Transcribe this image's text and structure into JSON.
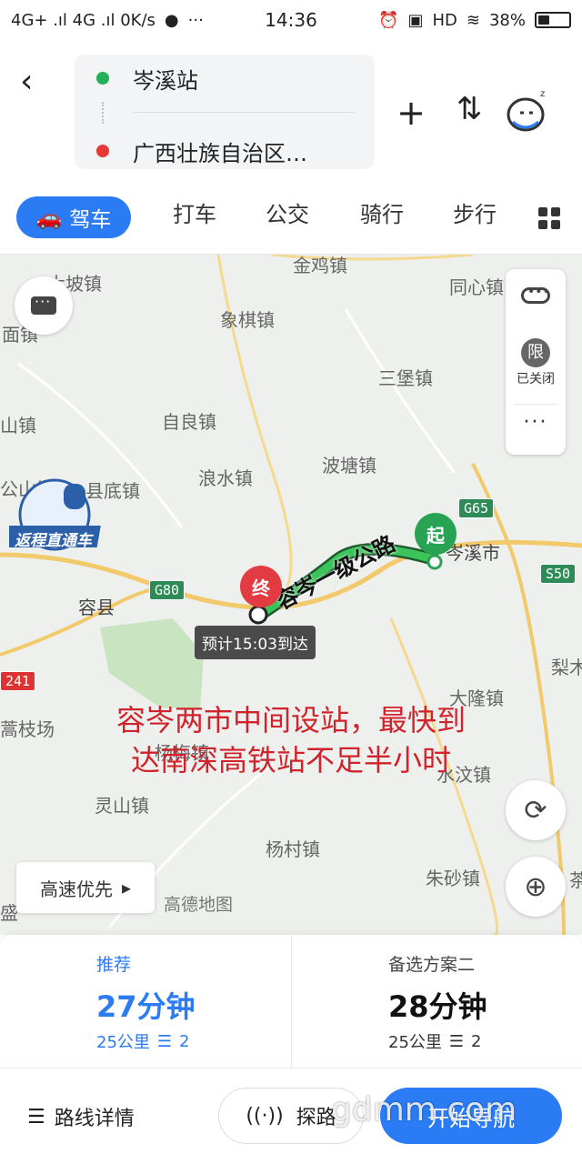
{
  "status_bar": {
    "network": "4G+ .ıl 4G .ıl 0K/s",
    "extra": "···",
    "time": "14:36",
    "right": "HD",
    "battery": "38%"
  },
  "header": {
    "origin": "岑溪站",
    "destination": "广西壮族自治区…",
    "colors": {
      "origin_dot": "#22b05a",
      "destination_dot": "#e53935"
    }
  },
  "tabs": {
    "active": "驾车",
    "items": [
      "打车",
      "公交",
      "骑行",
      "步行"
    ]
  },
  "map": {
    "places": [
      {
        "text": "金鸡镇"
      },
      {
        "text": "大坡镇"
      },
      {
        "text": "同心镇"
      },
      {
        "text": "象棋镇"
      },
      {
        "text": "三堡镇"
      },
      {
        "text": "面镇"
      },
      {
        "text": "自良镇"
      },
      {
        "text": "山镇"
      },
      {
        "text": "浪水镇"
      },
      {
        "text": "波塘镇"
      },
      {
        "text": "公山镇"
      },
      {
        "text": "县底镇"
      },
      {
        "text": "岑溪市"
      },
      {
        "text": "容县"
      },
      {
        "text": "梨木"
      },
      {
        "text": "大隆镇"
      },
      {
        "text": "蒿枝场"
      },
      {
        "text": "杨梅镇"
      },
      {
        "text": "水汶镇"
      },
      {
        "text": "灵山镇"
      },
      {
        "text": "杨村镇"
      },
      {
        "text": "朱砂镇"
      },
      {
        "text": "盛"
      },
      {
        "text": "茶"
      }
    ],
    "road_signs": [
      "G65",
      "G80",
      "S50",
      "241"
    ],
    "route_label": "容岑一级公路",
    "eta": "预计15:03到达",
    "caption_line1": "容岑两市中间设站，最快到",
    "caption_line2": "达南深高铁站不足半小时",
    "pin_start": "起",
    "pin_end": "终",
    "promo_text": "返程直通车",
    "limit": {
      "badge": "限",
      "status": "已关闭"
    },
    "speed_preference": "高速优先",
    "brand": "高德地图"
  },
  "plans": [
    {
      "label": "推荐",
      "duration": "27分钟",
      "distance": "25公里",
      "lights": "2"
    },
    {
      "label": "备选方案二",
      "duration": "28分钟",
      "distance": "25公里",
      "lights": "2"
    }
  ],
  "bottom": {
    "details": "路线详情",
    "explore": "探路",
    "start": "开始导航",
    "watermark": "gdmm.com"
  }
}
